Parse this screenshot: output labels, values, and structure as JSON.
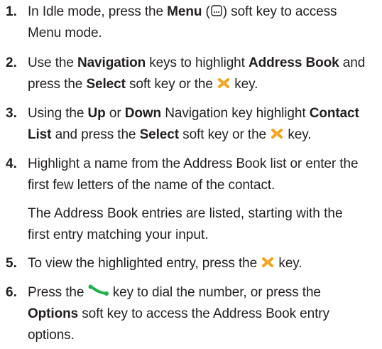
{
  "steps": [
    {
      "num": "1.",
      "l1_a": "In Idle mode, press the ",
      "l1_b": "Menu",
      "l1_c": " (",
      "l1_d": ") soft key to access",
      "l2": "Menu mode."
    },
    {
      "num": "2.",
      "l1_a": "Use the ",
      "l1_b": "Navigation",
      "l1_c": " keys to highlight ",
      "l1_d": "Address Book",
      "l1_e": " and",
      "l2_a": "press the ",
      "l2_b": "Select",
      "l2_c": " soft key or the ",
      "l2_d": " key."
    },
    {
      "num": "3.",
      "l1_a": "Using the ",
      "l1_b": "Up",
      "l1_c": " or ",
      "l1_d": "Down",
      "l1_e": " Navigation key highlight ",
      "l1_f": "Contact",
      "l2_a": "List",
      "l2_b": " and press the ",
      "l2_c": "Select",
      "l2_d": " soft key or the ",
      "l2_e": " key."
    },
    {
      "num": "4.",
      "l1": "Highlight a name from the Address Book list or enter the",
      "l2": "first few letters of the name of the contact."
    },
    {
      "num": "5.",
      "l1_a": "To view the highlighted entry, press the ",
      "l1_b": " key."
    },
    {
      "num": "6.",
      "l1_a": "Press the ",
      "l1_b": " key to dial the number, or press the",
      "l2_a": "Options",
      "l2_b": " soft key to access the Address Book entry",
      "l3": "options."
    }
  ],
  "note": {
    "l1": "The Address Book entries are listed, starting with the",
    "l2": "first entry matching your input."
  },
  "colors": {
    "text": "#231f20",
    "nav_key": "#f7a21b",
    "call_key": "#1fb14a"
  },
  "icons": [
    "menu-softkey-icon",
    "navigation-select-icon",
    "send-call-icon"
  ]
}
